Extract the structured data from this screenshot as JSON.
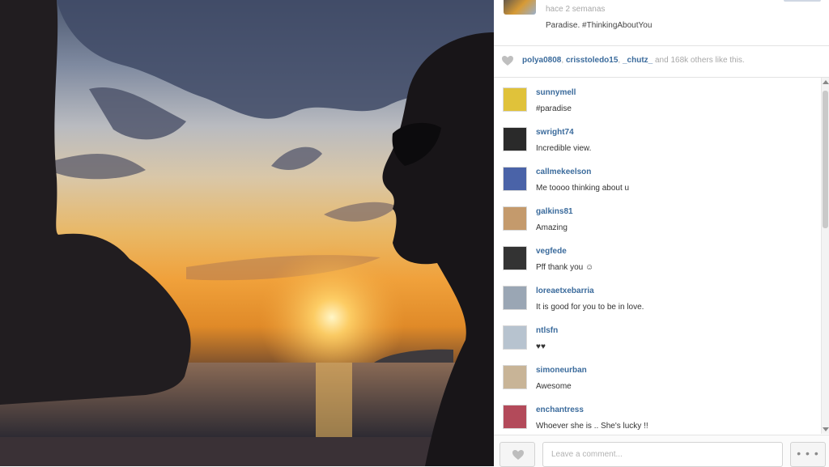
{
  "header": {
    "time": "hace 2 semanas",
    "caption": "Paradise. #ThinkingAboutYou"
  },
  "likes": {
    "user1": "polya0808",
    "sep1": ", ",
    "user2": "crisstoledo15",
    "sep2": ", ",
    "user3": "_chutz_",
    "rest": " and 168k others like this."
  },
  "comments": [
    {
      "user": "sunnymell",
      "text": "#paradise",
      "avatar": "#e0c23a"
    },
    {
      "user": "swright74",
      "text": "Incredible view.",
      "avatar": "#2a2a2a"
    },
    {
      "user": "callmekeelson",
      "text": "Me toooo thinking about u",
      "avatar": "#4a63a8"
    },
    {
      "user": "galkins81",
      "text": "Amazing",
      "avatar": "#c49a6c"
    },
    {
      "user": "vegfede",
      "text": "Pff thank you ☺",
      "avatar": "#333333"
    },
    {
      "user": "loreaetxebarria",
      "text": "It is good for you to be in love.",
      "avatar": "#9aa6b4"
    },
    {
      "user": "ntlsfn",
      "text": "♥♥",
      "avatar": "#b7c3cf"
    },
    {
      "user": "simoneurban",
      "text": "Awesome",
      "avatar": "#c8b497"
    },
    {
      "user": "enchantress",
      "text": "Whoever she is .. She's lucky !!",
      "avatar": "#b34a5a"
    }
  ],
  "footer": {
    "placeholder": "Leave a comment...",
    "more": "• • •"
  },
  "colors": {
    "username": "#3b6b9c",
    "muted": "#a8a8a8"
  },
  "icons": {
    "like": "heart-icon",
    "more": "ellipsis-icon",
    "scroll_up": "arrow-up-icon",
    "scroll_down": "arrow-down-icon"
  }
}
